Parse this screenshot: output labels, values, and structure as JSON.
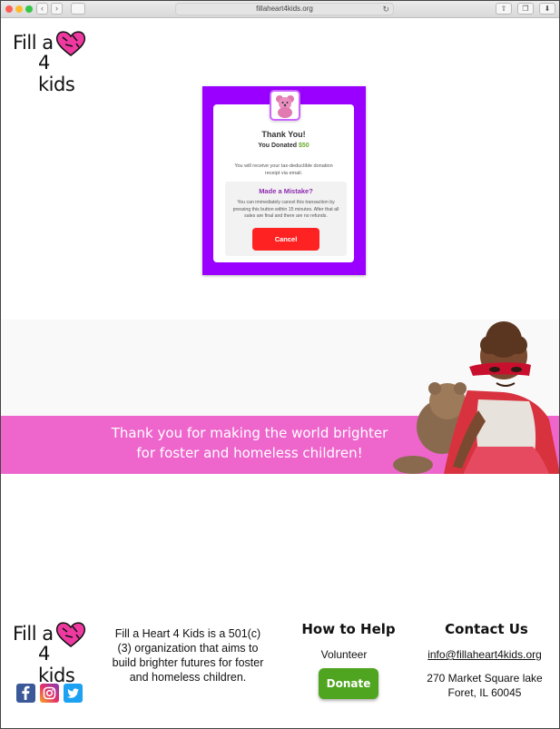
{
  "browser": {
    "url": "fillaheart4kids.org",
    "back_icon": "chevron-left-icon",
    "forward_icon": "chevron-right-icon"
  },
  "logo": {
    "line1": "Fill a",
    "line2": "4 kids"
  },
  "donation_card": {
    "title": "Thank You!",
    "donated_prefix": "You Donated",
    "amount": "$50",
    "receipt_text": "You will receive your tax-deductible donation receipt via email.",
    "mistake_title": "Made a Mistake?",
    "mistake_text": "You can immediately cancel this transaction by pressing this button within 15 minutes. After that all sales are final and there are no refunds.",
    "cancel_label": "Cancel"
  },
  "banner": {
    "line1": "Thank you for making the world brighter",
    "line2": "for foster and homeless children!"
  },
  "footer": {
    "about": "Fill a Heart 4 Kids is a 501(c)(3) organization that aims to build brighter futures for foster and homeless children.",
    "help_title": "How to Help",
    "volunteer_label": "Volunteer",
    "donate_label": "Donate",
    "contact_title": "Contact Us",
    "email": "info@fillaheart4kids.org",
    "address_line1": "270 Market Square lake",
    "address_line2": "Foret, IL 60045",
    "social": [
      "facebook-icon",
      "instagram-icon",
      "twitter-icon"
    ]
  },
  "colors": {
    "card_frame": "#9900ff",
    "accent_pink": "#ee66cc",
    "donate_green": "#4fa51f",
    "cancel_red": "#ff2222",
    "amount_green": "#6aab2e"
  }
}
